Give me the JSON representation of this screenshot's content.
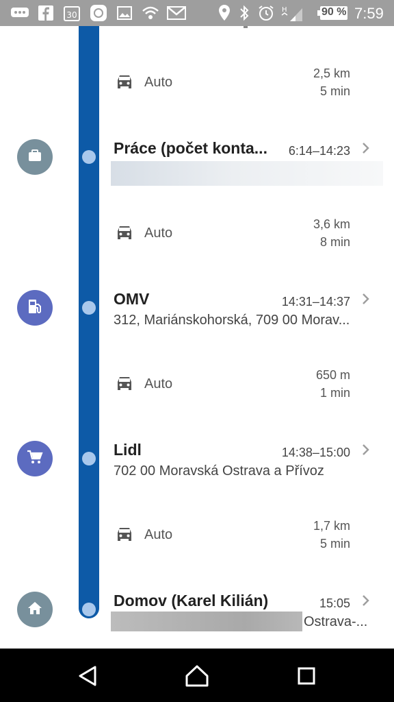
{
  "status_bar": {
    "battery": "90 %",
    "time": "7:59",
    "left_icons": [
      "chat-bubble-icon",
      "facebook-icon",
      "calendar-icon",
      "mi-app-icon",
      "gallery-icon",
      "wifi-signal-icon",
      "gmail-icon"
    ],
    "right_icons": [
      "location-pin-icon",
      "bluetooth-icon",
      "alarm-icon",
      "data-h-icon",
      "signal-icon",
      "battery-icon"
    ]
  },
  "timeline": {
    "rail_color": "#0d5aa7",
    "transits": [
      {
        "mode": "Auto",
        "distance": "2,5 km",
        "duration": "5 min"
      },
      {
        "mode": "Auto",
        "distance": "3,6 km",
        "duration": "8 min"
      },
      {
        "mode": "Auto",
        "distance": "650 m",
        "duration": "1 min"
      },
      {
        "mode": "Auto",
        "distance": "1,7 km",
        "duration": "5 min"
      }
    ],
    "places": [
      {
        "name": "Práce (počet konta...",
        "time": "6:14–14:23",
        "address": "",
        "icon": "briefcase-icon",
        "color": "#78909c"
      },
      {
        "name": "OMV",
        "time": "14:31–14:37",
        "address": "312, Mariánskohorská, 709 00 Morav...",
        "icon": "gas-station-icon",
        "color": "#5c6bc0"
      },
      {
        "name": "Lidl",
        "time": "14:38–15:00",
        "address": "702 00 Moravská Ostrava a Přívoz",
        "icon": "shopping-cart-icon",
        "color": "#5c6bc0"
      },
      {
        "name": "Domov (Karel Kilián)",
        "time": "15:05",
        "address": "Ostrava-...",
        "icon": "home-icon",
        "color": "#78909c"
      }
    ]
  },
  "nav_bar": {
    "buttons": [
      "back-button",
      "home-button",
      "recents-button"
    ]
  }
}
